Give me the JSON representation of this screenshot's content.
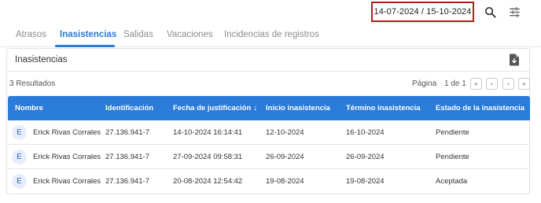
{
  "filter": {
    "date_range": "14-07-2024 / 15-10-2024"
  },
  "toolbar": {
    "search_icon": "search-icon",
    "filter_icon": "tune-icon"
  },
  "tabs": [
    {
      "label": "Atrasos",
      "active": false
    },
    {
      "label": "Inasistencias",
      "active": true
    },
    {
      "label": "Salidas",
      "active": false
    },
    {
      "label": "Vacaciones",
      "active": false
    },
    {
      "label": "Incidencias de registros",
      "active": false
    }
  ],
  "card": {
    "title": "Inasistencias",
    "export_icon": "file-download-icon"
  },
  "results": {
    "summary": "3 Resultados"
  },
  "pagination": {
    "label": "Página",
    "count": "1 de 1",
    "first": "«",
    "prev": "‹",
    "next": "›",
    "last": "»"
  },
  "table": {
    "columns": [
      "Nombre",
      "Identificación",
      "Fecha de justificación",
      "Inicio inasistencia",
      "Término inasistencia",
      "Estado de la inasistencia"
    ],
    "sort_indicator": "↓",
    "rows": [
      {
        "initial": "E",
        "name": "Erick Rivas Corrales",
        "id": "27.136.941-7",
        "justified": "14-10-2024 16:14:41",
        "start": "12-10-2024",
        "end": "16-10-2024",
        "status": "Pendiente"
      },
      {
        "initial": "E",
        "name": "Erick Rivas Corrales",
        "id": "27.136.941-7",
        "justified": "27-09-2024 09:58:31",
        "start": "26-09-2024",
        "end": "26-09-2024",
        "status": "Pendiente"
      },
      {
        "initial": "E",
        "name": "Erick Rivas Corrales",
        "id": "27.136.941-7",
        "justified": "20-08-2024 12:54:42",
        "start": "19-08-2024",
        "end": "19-08-2024",
        "status": "Aceptada"
      }
    ]
  },
  "colors": {
    "accent": "#2b7bd9",
    "highlight_border": "#b11d1d"
  }
}
